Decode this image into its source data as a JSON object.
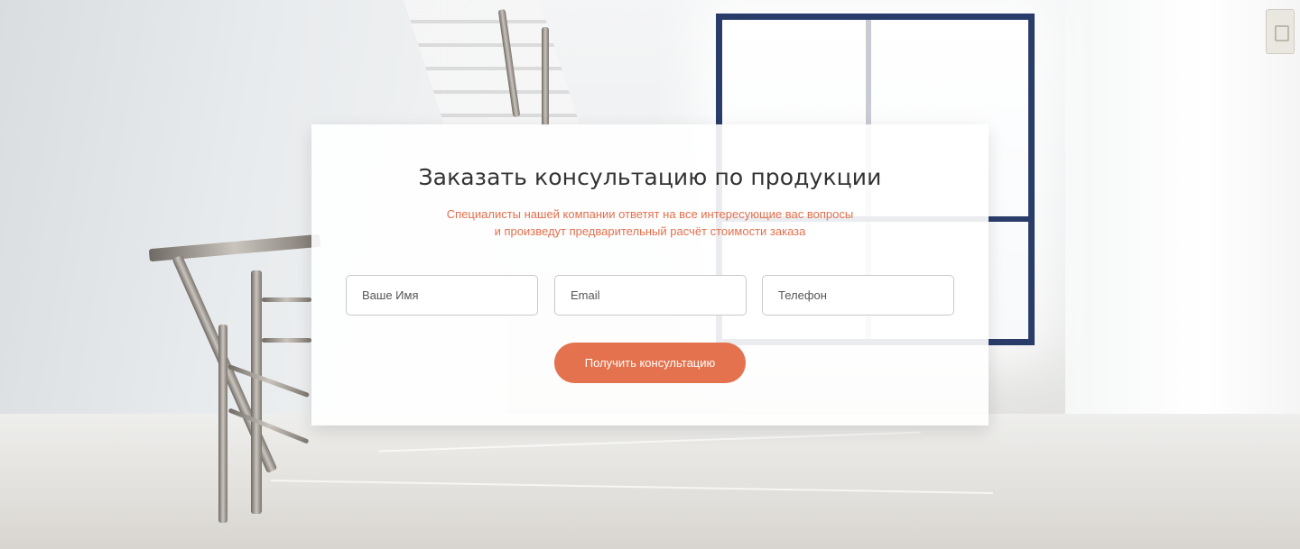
{
  "consultation": {
    "title": "Заказать консультацию по продукции",
    "subtitle_line1": "Специалисты нашей компании ответят на все интересующие вас вопросы",
    "subtitle_line2": "и произведут предварительный расчёт стоимости заказа",
    "fields": {
      "name_placeholder": "Ваше Имя",
      "email_placeholder": "Email",
      "phone_placeholder": "Телефон"
    },
    "submit_label": "Получить консультацию"
  },
  "colors": {
    "accent": "#e4724e",
    "subtitle": "#e46f4c",
    "title": "#333333",
    "window_frame": "#2a3d6a"
  }
}
